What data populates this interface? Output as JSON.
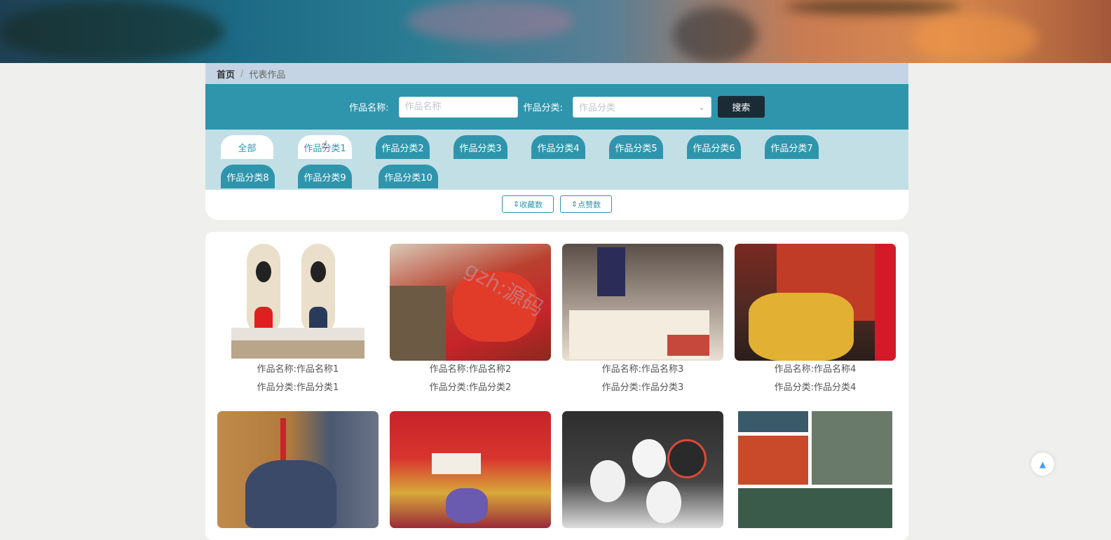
{
  "breadcrumb": {
    "home": "首页",
    "separator": "/",
    "current": "代表作品"
  },
  "search": {
    "name_label": "作品名称:",
    "name_placeholder": "作品名称",
    "category_label": "作品分类:",
    "category_placeholder": "作品分类",
    "button": "搜索"
  },
  "categories": [
    "全部",
    "作品分类1",
    "作品分类2",
    "作品分类3",
    "作品分类4",
    "作品分类5",
    "作品分类6",
    "作品分类7",
    "作品分类8",
    "作品分类9",
    "作品分类10"
  ],
  "sort": {
    "favorites": "收藏数",
    "likes": "点赞数"
  },
  "items": [
    {
      "name": "作品名称:作品名称1",
      "category": "作品分类:作品分类1"
    },
    {
      "name": "作品名称:作品名称2",
      "category": "作品分类:作品分类2"
    },
    {
      "name": "作品名称:作品名称3",
      "category": "作品分类:作品分类3"
    },
    {
      "name": "作品名称:作品名称4",
      "category": "作品分类:作品分类4"
    },
    {
      "name": "",
      "category": ""
    },
    {
      "name": "",
      "category": ""
    },
    {
      "name": "",
      "category": ""
    },
    {
      "name": "",
      "category": ""
    }
  ],
  "watermark": "gzh:源码",
  "colors": {
    "primary": "#2f95ad",
    "dark_button": "#1b2b36",
    "category_bg": "#c2dfe6",
    "breadcrumb_bg": "#c5d4e4"
  }
}
